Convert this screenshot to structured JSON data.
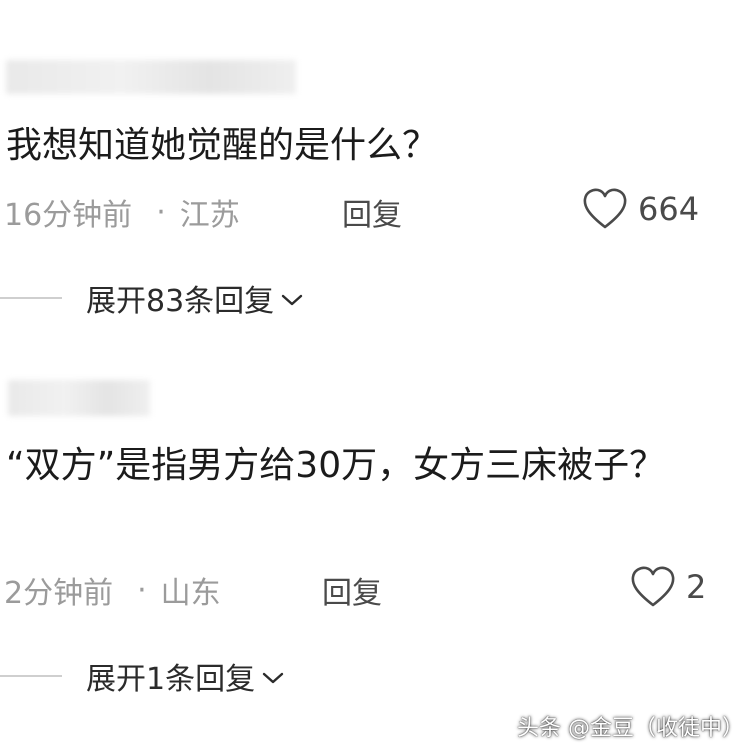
{
  "comments": [
    {
      "text": "我想知道她觉醒的是什么？",
      "time": "16分钟前",
      "separator": "·",
      "location": "江苏",
      "reply_label": "回复",
      "like_count": "664",
      "expand_label": "展开83条回复"
    },
    {
      "text": "“双方”是指男方给30万，女方三床被子？",
      "time": "2分钟前",
      "separator": "·",
      "location": "山东",
      "reply_label": "回复",
      "like_count": "2",
      "expand_label": "展开1条回复"
    }
  ],
  "watermark": "头条 @金豆（收徒中）",
  "icons": {
    "like": "heart-outline-icon",
    "expand": "chevron-down-icon"
  },
  "colors": {
    "text": "#1b1b1b",
    "meta": "#9b9b9b",
    "action": "#4a4a4a"
  }
}
